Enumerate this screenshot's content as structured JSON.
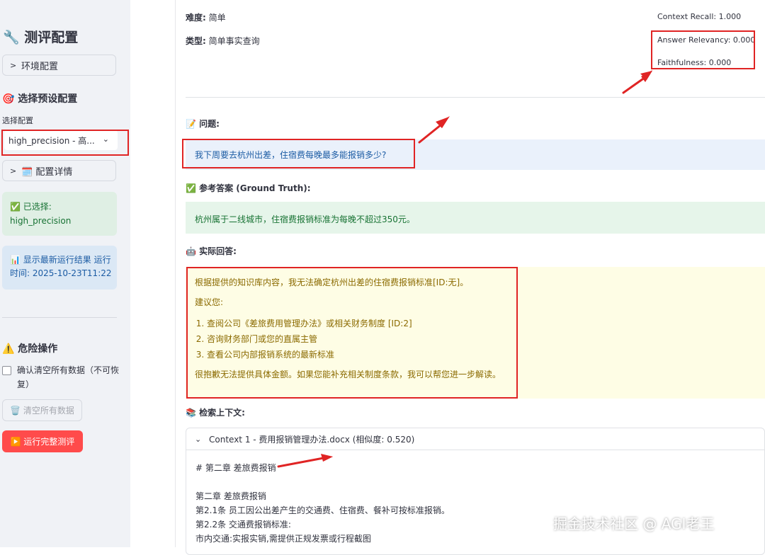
{
  "sidebar": {
    "title": "🔧 测评配置",
    "env_expander": "环境配置",
    "preset_heading": "🎯 选择预设配置",
    "select_label": "选择配置",
    "select_value": "high_precision - 高...",
    "details_expander": "🗓️ 配置详情",
    "selected_label": "✅ 已选择:",
    "selected_value": "high_precision",
    "info_text": "📊 显示最新运行结果 运行时间: 2025-10-23T11:22",
    "danger_heading": "⚠️ 危险操作",
    "confirm_checkbox": "确认清空所有数据（不可恢复）",
    "clear_button": "🗑️ 清空所有数据",
    "run_button": "▶️ 运行完整测评"
  },
  "main": {
    "difficulty_label": "难度:",
    "difficulty_value": "简单",
    "type_label": "类型:",
    "type_value": "简单事实查询",
    "metrics": {
      "context_recall": "Context Recall: 1.000",
      "answer_relevancy": "Answer Relevancy: 0.000",
      "faithfulness": "Faithfulness: 0.000"
    },
    "question_heading": "📝 问题:",
    "question_text": "我下周要去杭州出差，住宿费每晚最多能报销多少?",
    "ground_truth_heading": "✅ 参考答案 (Ground Truth):",
    "ground_truth_text": "杭州属于二线城市，住宿费报销标准为每晚不超过350元。",
    "actual_heading": "🤖 实际回答:",
    "answer": {
      "intro": "根据提供的知识库内容，我无法确定杭州出差的住宿费报销标准[ID:无]。",
      "suggest": "建议您:",
      "items": [
        "查阅公司《差旅费用管理办法》或相关财务制度 [ID:2]",
        "咨询财务部门或您的直属主管",
        "查看公司内部报销系统的最新标准"
      ],
      "closing": "很抱歉无法提供具体金额。如果您能补充相关制度条款，我可以帮您进一步解读。"
    },
    "context_heading": "📚 检索上下文:",
    "context": {
      "header": "Context 1 - 费用报销管理办法.docx (相似度: 0.520)",
      "lines": [
        "# 第二章 差旅费报销",
        "",
        "第二章 差旅费报销",
        "第2.1条 员工因公出差产生的交通费、住宿费、餐补可按标准报销。",
        "第2.2条 交通费报销标准:",
        "市内交通:实报实销,需提供正规发票或行程截图"
      ]
    },
    "watermark": "掘金技术社区 @ AGI老王"
  },
  "colors": {
    "accent_red": "#ff4b4b",
    "annotation_red": "#e02424"
  }
}
